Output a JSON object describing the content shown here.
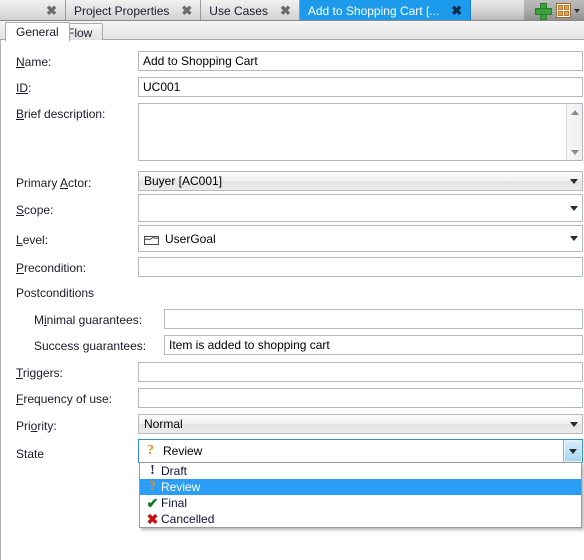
{
  "window": {
    "outer_tabs": [
      {
        "label": "",
        "close": "✖",
        "active": false,
        "partial": true
      },
      {
        "label": "Project Properties",
        "close": "✖",
        "active": false,
        "partial": false
      },
      {
        "label": "Use Cases",
        "close": "✖",
        "active": false,
        "partial": false
      },
      {
        "label": "Add to Shopping Cart [...",
        "close": "✖",
        "active": true,
        "partial": false
      }
    ],
    "strip_buttons": [
      {
        "name": "add-tab-button",
        "label": "+"
      },
      {
        "name": "tab-list-button",
        "label": "▾"
      }
    ]
  },
  "inner_tabs": [
    {
      "label": "General",
      "selected": true
    },
    {
      "label": "Flow",
      "selected": false
    }
  ],
  "form": {
    "name": {
      "label_pre": "N",
      "label_accel": "a",
      "label_post": "me:",
      "value": "Add to Shopping Cart",
      "placeholder": ""
    },
    "id": {
      "label_pre": "",
      "label_accel": "ID",
      "label_post": ":",
      "value": "UC001",
      "placeholder": ""
    },
    "brief_description": {
      "label_pre": "",
      "label_accel": "B",
      "label_post": "rief description:",
      "value": "",
      "placeholder": ""
    },
    "primary_actor": {
      "label_pre": "Primary ",
      "label_accel": "A",
      "label_post": "ctor:",
      "value": "Buyer [AC001]"
    },
    "scope": {
      "label_pre": "",
      "label_accel": "S",
      "label_post": "cope:",
      "value": ""
    },
    "level": {
      "label_pre": "",
      "label_accel": "L",
      "label_post": "evel:",
      "value": "UserGoal",
      "icon": "sea-level-icon"
    },
    "precondition": {
      "label_pre": "",
      "label_accel": "P",
      "label_post": "recondition:",
      "value": ""
    },
    "postconditions_group": {
      "label": "Postconditions"
    },
    "minimal_guarantees": {
      "label_pre": "M",
      "label_accel": "i",
      "label_post": "nimal guarantees:",
      "value": ""
    },
    "success_guarantees": {
      "label_pre": "Success ",
      "label_accel": "g",
      "label_post": "uarantees:",
      "value": "Item is added to shopping cart"
    },
    "triggers": {
      "label_pre": "",
      "label_accel": "T",
      "label_post": "riggers:",
      "value": ""
    },
    "frequency_of_use": {
      "label_pre": "",
      "label_accel": "F",
      "label_post": "requency of use:",
      "value": ""
    },
    "priority": {
      "label_pre": "Pri",
      "label_accel": "o",
      "label_post": "rity:",
      "value": "Normal"
    },
    "state": {
      "label_pre": "State",
      "label_accel": "",
      "label_post": "",
      "value": "Review",
      "icon": "question-mark-icon"
    }
  },
  "state_dropdown": {
    "open": true,
    "selected": "Review",
    "options": [
      {
        "label": "Draft",
        "icon": "exclamation-icon",
        "icon_glyph": "!",
        "highlighted": false
      },
      {
        "label": "Review",
        "icon": "question-mark-icon",
        "icon_glyph": "?",
        "highlighted": true
      },
      {
        "label": "Final",
        "icon": "check-icon",
        "icon_glyph": "✔",
        "highlighted": false
      },
      {
        "label": "Cancelled",
        "icon": "cross-icon",
        "icon_glyph": "✖",
        "highlighted": false
      }
    ]
  },
  "colors": {
    "active_tab": "#1c9aec",
    "highlight": "#2a9df4",
    "draft_icon": "#1b2a6b",
    "review_icon": "#f08a1e",
    "final_icon": "#0b7a28",
    "cancel_icon": "#c41212",
    "add_button": "#3ba13b"
  },
  "scrollbar": {
    "up": "▲",
    "down": "▼"
  }
}
